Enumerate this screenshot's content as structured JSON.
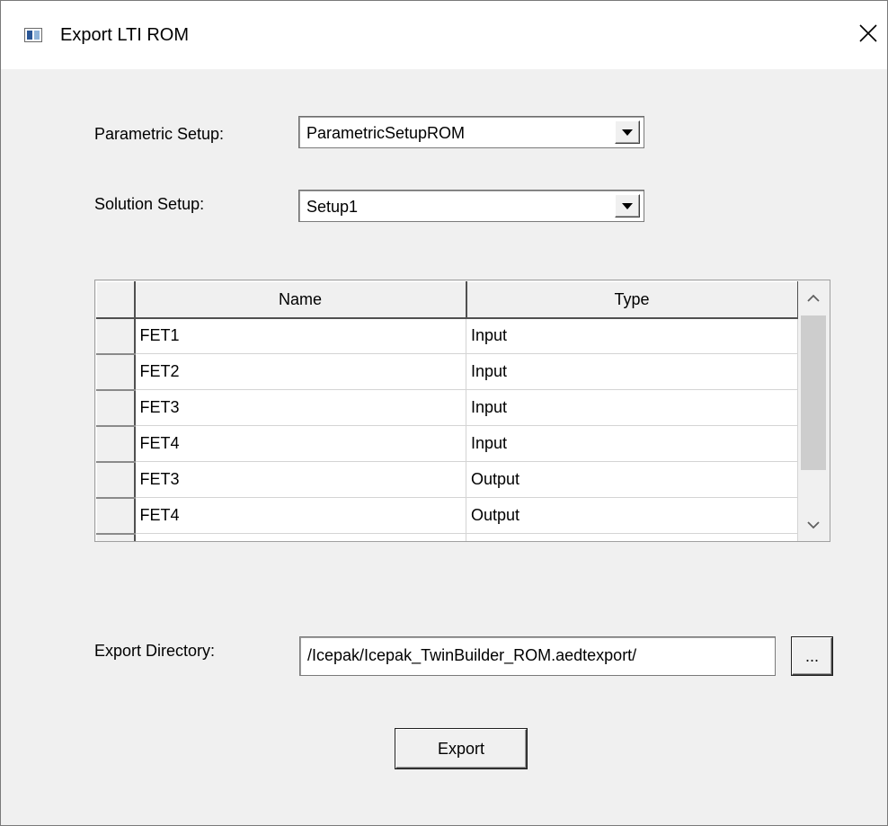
{
  "window": {
    "title": "Export LTI ROM"
  },
  "parametric_setup": {
    "label": "Parametric Setup:",
    "value": "ParametricSetupROM"
  },
  "solution_setup": {
    "label": "Solution Setup:",
    "value": "Setup1"
  },
  "table": {
    "columns": [
      "Name",
      "Type"
    ],
    "rows": [
      {
        "name": "FET1",
        "type": "Input"
      },
      {
        "name": "FET2",
        "type": "Input"
      },
      {
        "name": "FET3",
        "type": "Input"
      },
      {
        "name": "FET4",
        "type": "Input"
      },
      {
        "name": "FET3",
        "type": "Output"
      },
      {
        "name": "FET4",
        "type": "Output"
      }
    ]
  },
  "export_directory": {
    "label": "Export Directory:",
    "value": "/Icepak/Icepak_TwinBuilder_ROM.aedtexport/",
    "browse_label": "..."
  },
  "export_button": {
    "label": "Export"
  }
}
